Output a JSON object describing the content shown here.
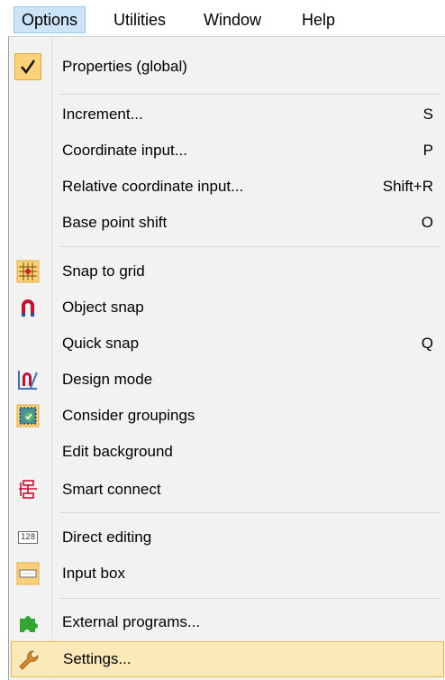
{
  "menubar": {
    "items": [
      {
        "label": "Options",
        "active": true
      },
      {
        "label": "Utilities"
      },
      {
        "label": "Window"
      },
      {
        "label": "Help"
      }
    ]
  },
  "menu": {
    "items": [
      {
        "label": "Properties (global)",
        "shortcut": "",
        "icon": "checkmark-icon",
        "checked": true
      },
      {
        "label": "Increment...",
        "shortcut": "S",
        "icon": ""
      },
      {
        "label": "Coordinate input...",
        "shortcut": "P",
        "icon": ""
      },
      {
        "label": "Relative coordinate input...",
        "shortcut": "Shift+R",
        "icon": ""
      },
      {
        "label": "Base point shift",
        "shortcut": "O",
        "icon": ""
      },
      {
        "label": "Snap to grid",
        "shortcut": "",
        "icon": "snap-grid-icon"
      },
      {
        "label": "Object snap",
        "shortcut": "",
        "icon": "magnet-icon"
      },
      {
        "label": "Quick snap",
        "shortcut": "Q",
        "icon": ""
      },
      {
        "label": "Design mode",
        "shortcut": "",
        "icon": "design-mode-icon"
      },
      {
        "label": "Consider groupings",
        "shortcut": "",
        "icon": "grouping-icon"
      },
      {
        "label": "Edit background",
        "shortcut": "",
        "icon": ""
      },
      {
        "label": "Smart connect",
        "shortcut": "",
        "icon": "smart-connect-icon"
      },
      {
        "label": "Direct editing",
        "shortcut": "",
        "icon": "direct-editing-icon",
        "icon_text": "128"
      },
      {
        "label": "Input box",
        "shortcut": "",
        "icon": "input-box-icon"
      },
      {
        "label": "External programs...",
        "shortcut": "",
        "icon": "puzzle-icon"
      },
      {
        "label": "Settings...",
        "shortcut": "",
        "icon": "wrench-icon",
        "highlighted": true
      }
    ]
  },
  "colors": {
    "menu_bg": "#f2f2f2",
    "highlight_bg": "#fce9b8",
    "highlight_border": "#e8b64a",
    "active_menu_bg": "#cce4f7",
    "check_bg": "#fbd27a"
  }
}
